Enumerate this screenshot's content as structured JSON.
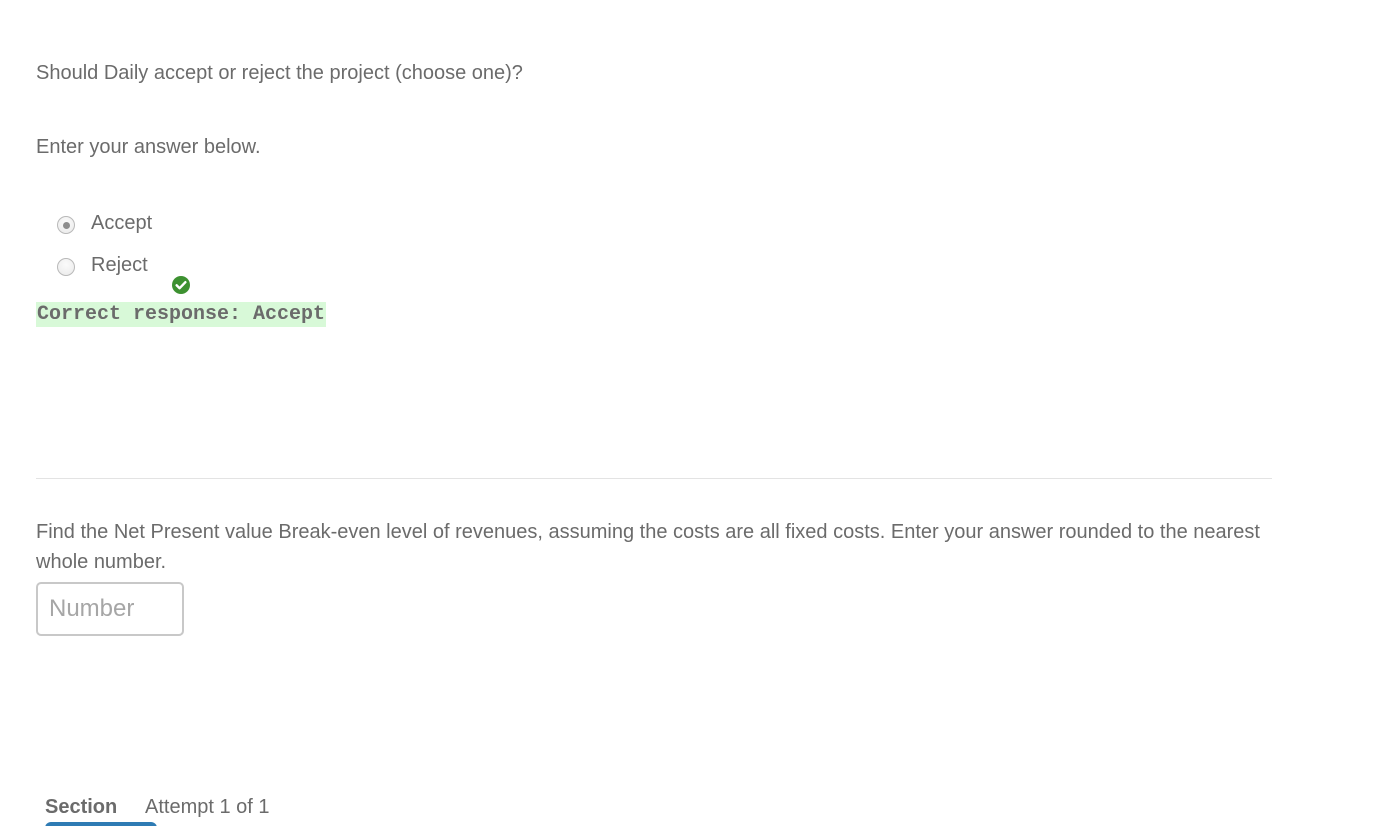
{
  "question1": {
    "prompt": "Should Daily accept or reject the project (choose one)?",
    "instruction": "Enter your answer below.",
    "options": [
      {
        "label": "Accept",
        "selected": true
      },
      {
        "label": "Reject",
        "selected": false
      }
    ],
    "feedback_icon": "check-circle-icon",
    "correct_response": "Correct response: Accept",
    "colors": {
      "correct_highlight": "#d8f9d8",
      "check_green": "#3d9131"
    }
  },
  "question2": {
    "prompt": "Find the Net Present value Break-even level of revenues, assuming the costs are all fixed costs.  Enter your answer rounded to the nearest whole number.",
    "input_value": "",
    "input_placeholder": "Number"
  },
  "footer": {
    "section_label": "Section",
    "attempt_text": "Attempt 1 of 1",
    "button_color": "#2e7bb4"
  }
}
